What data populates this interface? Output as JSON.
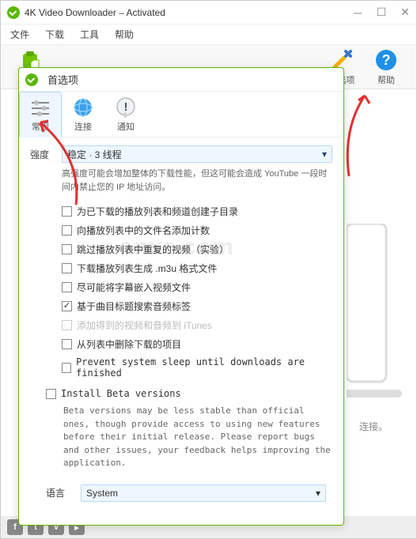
{
  "titlebar": {
    "title": "4K Video Downloader – Activated"
  },
  "menubar": {
    "file": "文件",
    "download": "下载",
    "tools": "工具",
    "help": "帮助"
  },
  "toolbar": {
    "paste": "粘",
    "prefs": "首选项",
    "helpBtn": "帮助"
  },
  "dialog": {
    "title": "首选项",
    "tabs": {
      "general": "常规",
      "connection": "连接",
      "notify": "通知"
    },
    "intensity": {
      "label": "强度",
      "value": "稳定 · 3 线程",
      "hint": "高强度可能会增加整体的下载性能，但这可能会造成 YouTube 一段时间内禁止您的 IP 地址访问。"
    },
    "checks": {
      "c1": "为已下载的播放列表和频道创建子目录",
      "c2": "向播放列表中的文件名添加计数",
      "c3": "跳过播放列表中重复的视频（实验）",
      "c4": "下载播放列表生成 .m3u 格式文件",
      "c5": "尽可能将字幕嵌入视频文件",
      "c6": "基于曲目标题搜索音频标签",
      "c7": "添加得到的视频和音频到 iTunes",
      "c8": "从列表中删除下载的项目",
      "c9": "Prevent system sleep until downloads are finished"
    },
    "beta": {
      "label": "Install Beta versions",
      "desc": "Beta versions may be less stable than official ones, though provide access to using new features before their initial release. Please report bugs and other issues, your feedback helps improving the application."
    },
    "lang": {
      "label": "语言",
      "value": "System"
    }
  },
  "content": {
    "connect": "连接。"
  },
  "watermark": "anxz.com"
}
